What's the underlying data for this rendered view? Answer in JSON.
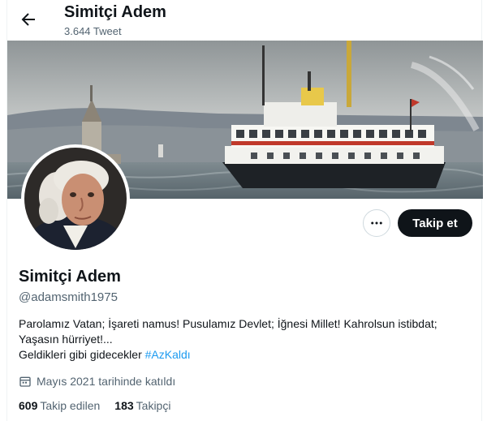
{
  "header": {
    "back_icon": "arrow-left-icon",
    "title": "Simitçi Adem",
    "tweet_count": "3.644 Tweet"
  },
  "profile": {
    "name": "Simitçi Adem",
    "handle": "@adamsmith1975",
    "bio_line1": "Parolamız Vatan; İşareti namus! Pusulamız Devlet; İğnesi Millet! Kahrolsun istibdat;",
    "bio_line2": "Yaşasın hürriyet!...",
    "bio_line3_prefix": "Geldikleri gibi gidecekler ",
    "bio_hashtag": "#AzKaldı",
    "joined": "Mayıs 2021 tarihinde katıldı",
    "following_count": "609",
    "following_label": "Takip edilen",
    "followers_count": "183",
    "followers_label": "Takipçi"
  },
  "actions": {
    "more_icon": "more-horizontal-icon",
    "follow_label": "Takip et"
  },
  "colors": {
    "text": "#0f1419",
    "secondary": "#536471",
    "link": "#1d9bf0",
    "button": "#0f1419"
  }
}
